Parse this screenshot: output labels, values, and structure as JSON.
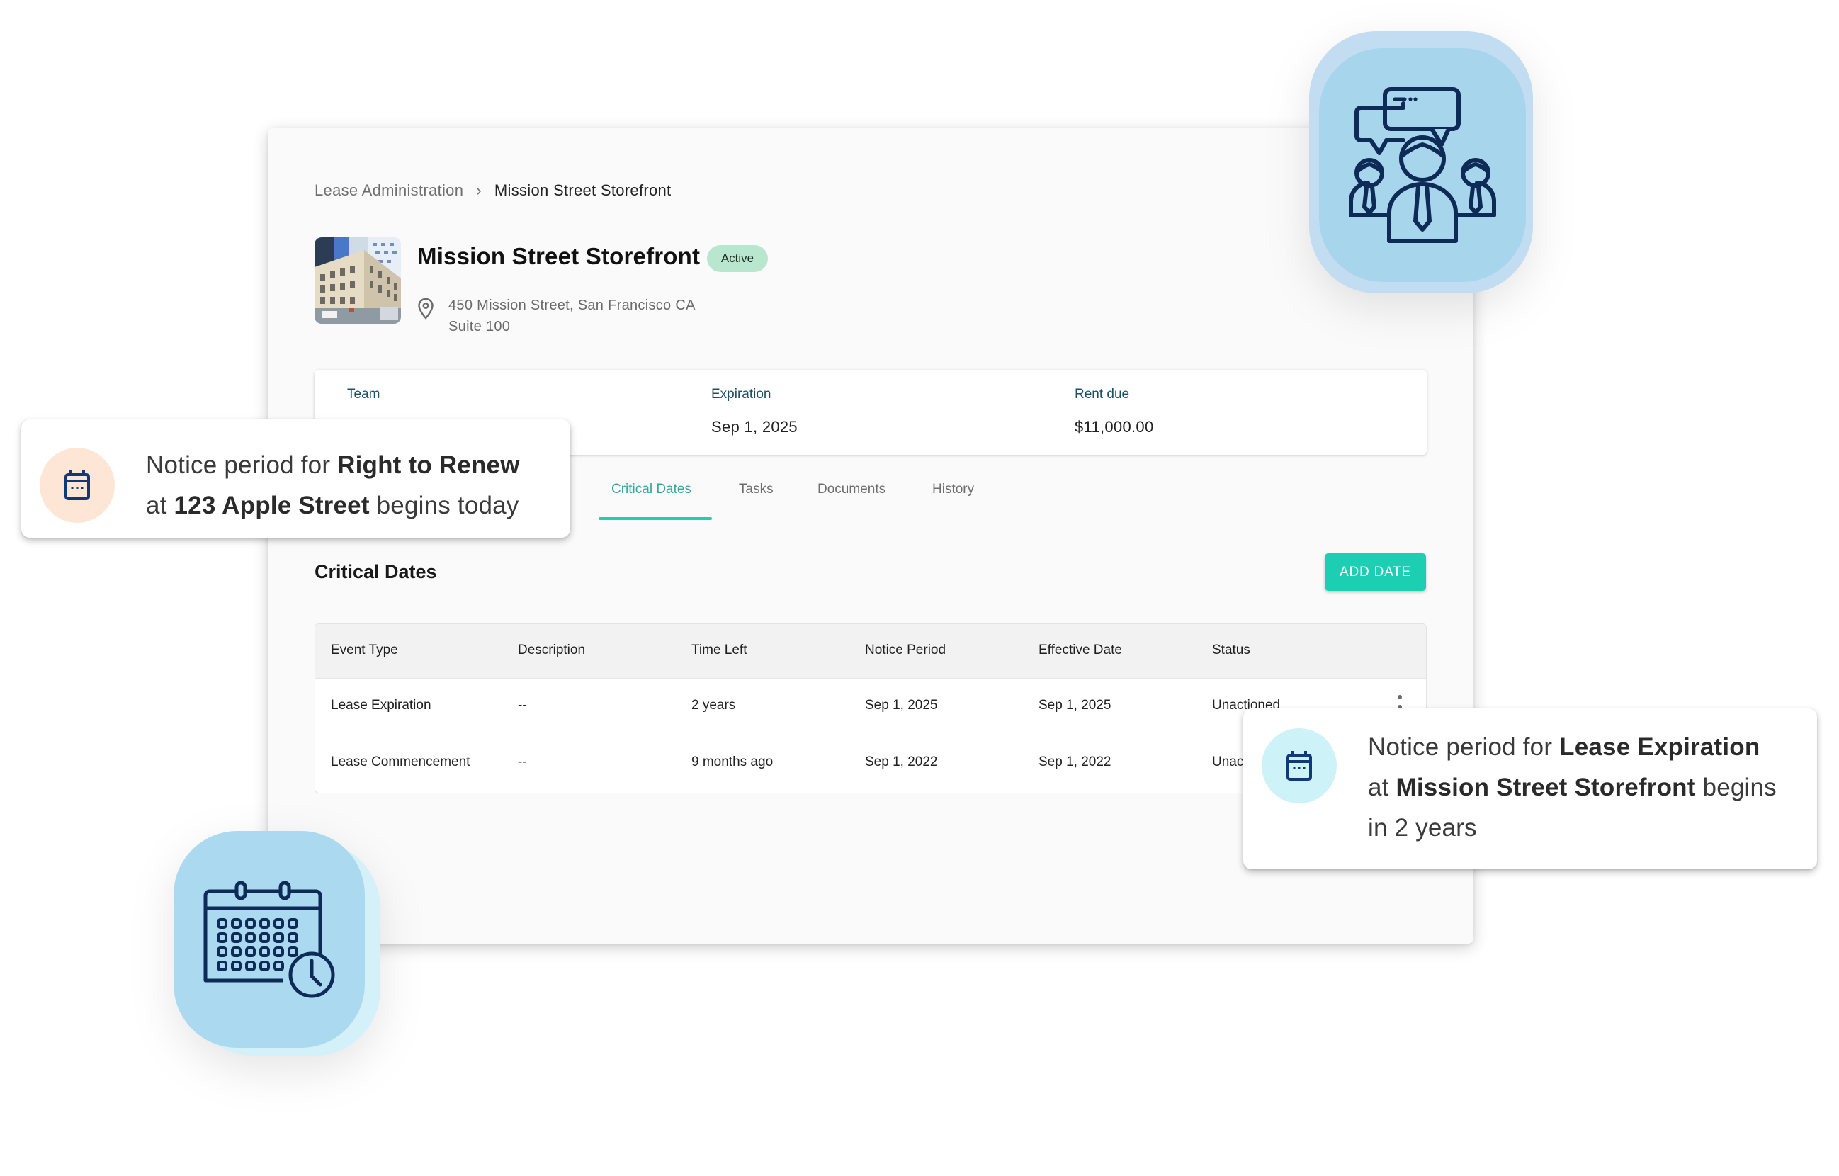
{
  "breadcrumb": {
    "parent": "Lease Administration",
    "separator": "›",
    "current": "Mission Street Storefront"
  },
  "property": {
    "title": "Mission Street Storefront",
    "status": "Active",
    "address_line1": "450 Mission Street, San Francisco CA",
    "address_line2": "Suite 100",
    "photo_icon": "building-photo"
  },
  "summary": {
    "fields": [
      {
        "label": "Team",
        "value": ""
      },
      {
        "label": "Expiration",
        "value": "Sep 1, 2025"
      },
      {
        "label": "Rent due",
        "value": "$11,000.00"
      }
    ]
  },
  "tabs": [
    {
      "label": "Critical Dates",
      "active": true
    },
    {
      "label": "Tasks",
      "active": false
    },
    {
      "label": "Documents",
      "active": false
    },
    {
      "label": "History",
      "active": false
    }
  ],
  "section": {
    "title": "Critical Dates",
    "add_button": "ADD DATE"
  },
  "table": {
    "columns": [
      "Event Type",
      "Description",
      "Time Left",
      "Notice Period",
      "Effective Date",
      "Status"
    ],
    "rows": [
      [
        "Lease Expiration",
        "--",
        "2 years",
        "Sep 1, 2025",
        "Sep 1, 2025",
        "Unactioned"
      ],
      [
        "Lease Commencement",
        "--",
        "9 months ago",
        "Sep 1, 2022",
        "Sep 1, 2022",
        "Unactioned"
      ]
    ]
  },
  "notifications": [
    {
      "icon": "calendar-icon",
      "parts": [
        {
          "text": "Notice period for ",
          "bold": false
        },
        {
          "text": "Right to Renew",
          "bold": true
        },
        {
          "text": "\nat ",
          "bold": false
        },
        {
          "text": "123 Apple Street",
          "bold": true
        },
        {
          "text": " begins today",
          "bold": false
        }
      ]
    },
    {
      "icon": "calendar-icon",
      "parts": [
        {
          "text": "Notice period for ",
          "bold": false
        },
        {
          "text": "Lease Expiration",
          "bold": true
        },
        {
          "text": "\nat ",
          "bold": false
        },
        {
          "text": "Mission Street Storefront",
          "bold": true
        },
        {
          "text": " begins\nin 2 years",
          "bold": false
        }
      ]
    }
  ],
  "badges": {
    "top_right": "team-discussion-icon",
    "bottom_left": "calendar-clock-icon"
  },
  "colors": {
    "accent": "#1ccfb2",
    "tab_active_text": "#3aa39a",
    "status_active_bg": "#b8e6cf",
    "label_blue": "#1d4f66",
    "icon_navy": "#0e2a56",
    "badge_blue": "#a7d6ec",
    "toast_peach": "#fde6d6",
    "toast_cyan": "#cdf2f8"
  }
}
